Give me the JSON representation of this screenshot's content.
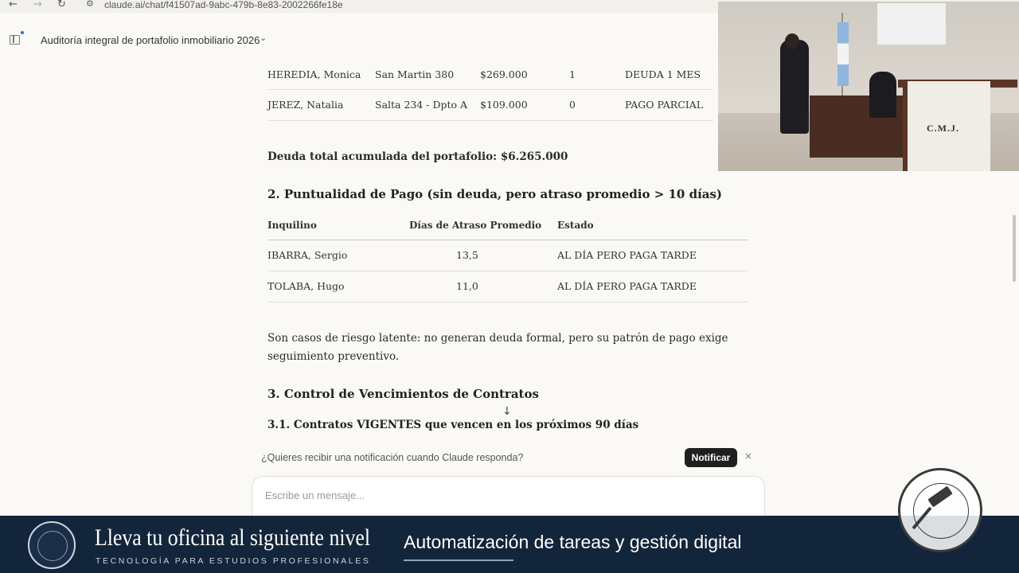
{
  "browser": {
    "url": "claude.ai/chat/f41507ad-9abc-479b-8e83-2002266fe18e",
    "back_icon": "arrow-left-icon",
    "forward_icon": "arrow-right-icon",
    "reload_icon": "reload-icon"
  },
  "header": {
    "chat_title": "Auditoría integral de portafolio inmobiliario 2026"
  },
  "debt_table": {
    "rows": [
      [
        "HEREDIA, Monica",
        "San Martin 380",
        "$269.000",
        "1",
        "DEUDA 1 MES"
      ],
      [
        "JEREZ, Natalia",
        "Salta 234 - Dpto A",
        "$109.000",
        "0",
        "PAGO PARCIAL"
      ]
    ]
  },
  "debt_total": {
    "label": "Deuda total acumulada del portafolio:",
    "value": "$6.265.000"
  },
  "section2": {
    "title": "2. Puntualidad de Pago (sin deuda, pero atraso promedio > 10 días)",
    "headers": [
      "Inquilino",
      "Días de Atraso Promedio",
      "Estado"
    ],
    "rows": [
      [
        "IBARRA, Sergio",
        "13,5",
        "AL DÍA PERO PAGA TARDE"
      ],
      [
        "TOLABA, Hugo",
        "11,0",
        "AL DÍA PERO PAGA TARDE"
      ]
    ],
    "note_line1": "Son casos de riesgo latente: no generan deuda formal, pero su patrón de pago exige",
    "note_line2": "seguimiento preventivo."
  },
  "section3": {
    "title": "3. Control de Vencimientos de Contratos",
    "subtitle": "3.1. Contratos VIGENTES que vencen en los próximos 90 días"
  },
  "notification": {
    "question": "¿Quieres recibir una notificación cuando Claude responda?",
    "button": "Notificar",
    "close": "×"
  },
  "composer": {
    "placeholder": "Escribe un mensaje..."
  },
  "webcam": {
    "sign": "C.M.J."
  },
  "banner": {
    "title": "Lleva tu oficina al siguiente nivel",
    "subtitle": "TECNOLOGÍA PARA ESTUDIOS PROFESIONALES",
    "tagline": "Automatización de tareas y gestión digital"
  }
}
